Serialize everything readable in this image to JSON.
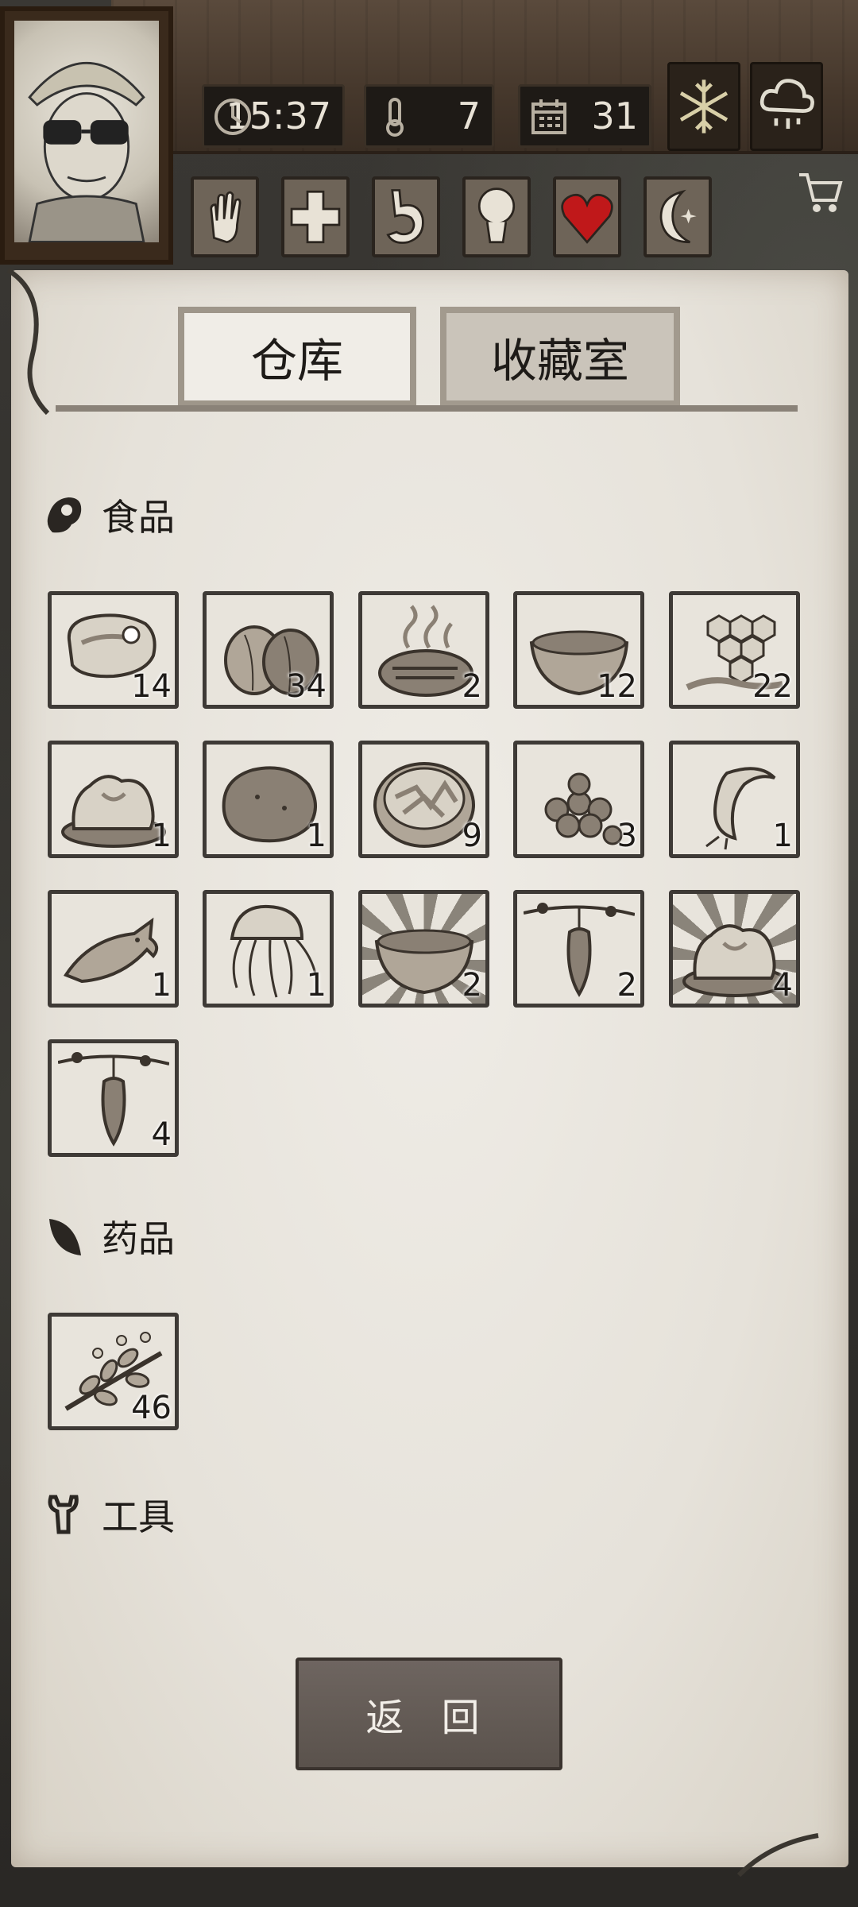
{
  "hud": {
    "time": "15:37",
    "temperature": "7",
    "day": "31",
    "weather_icons": [
      "snowflake-icon",
      "rain-cloud-icon"
    ],
    "status_icons": [
      "hand-icon",
      "health-cross-icon",
      "stomach-icon",
      "mind-icon",
      "heart-icon",
      "moon-icon"
    ],
    "heart_color": "#c0181a"
  },
  "tabs": {
    "active": "仓库",
    "inactive": "收藏室"
  },
  "sections": {
    "food": {
      "title": "食品",
      "items": [
        {
          "icon": "raw-meat-icon",
          "count": "14"
        },
        {
          "icon": "coconut-icon",
          "count": "34"
        },
        {
          "icon": "grilled-meat-icon",
          "count": "2"
        },
        {
          "icon": "soup-bowl-icon",
          "count": "12"
        },
        {
          "icon": "honeycomb-icon",
          "count": "22"
        },
        {
          "icon": "cooked-dish-icon",
          "count": "1"
        },
        {
          "icon": "potato-icon",
          "count": "1"
        },
        {
          "icon": "salad-bowl-icon",
          "count": "9"
        },
        {
          "icon": "berries-icon",
          "count": "3"
        },
        {
          "icon": "shrimp-icon",
          "count": "1"
        },
        {
          "icon": "fish-icon",
          "count": "1"
        },
        {
          "icon": "jellyfish-icon",
          "count": "1"
        },
        {
          "icon": "soup-bowl-icon",
          "count": "2"
        },
        {
          "icon": "hanging-fruit-icon",
          "count": "2"
        },
        {
          "icon": "cooked-dish-icon",
          "count": "4"
        },
        {
          "icon": "hanging-fruit-icon",
          "count": "4"
        }
      ]
    },
    "medicine": {
      "title": "药品",
      "items": [
        {
          "icon": "herb-icon",
          "count": "46"
        }
      ]
    },
    "tools": {
      "title": "工具"
    }
  },
  "back_button": "返 回"
}
